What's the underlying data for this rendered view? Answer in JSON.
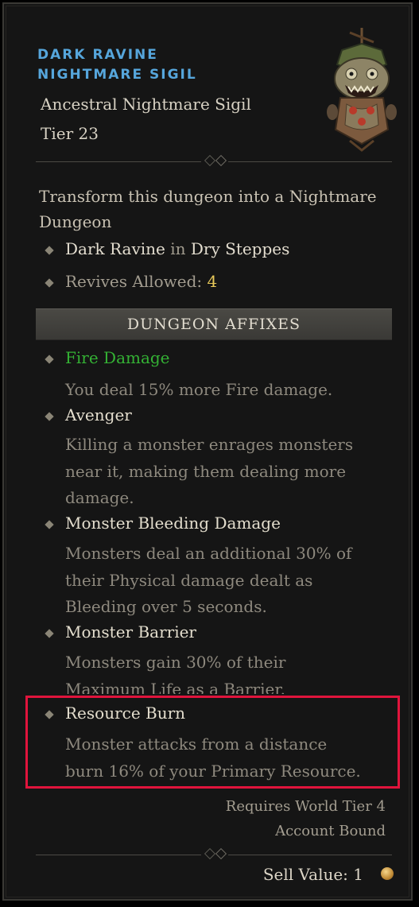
{
  "item": {
    "name_line1": "Dark Ravine",
    "name_line2": "Nightmare Sigil",
    "type": "Ancestral Nightmare Sigil",
    "tier": "Tier 23",
    "image_icon": "nightmare-sigil-icon"
  },
  "description": "Transform this dungeon into a Nightmare Dungeon",
  "location": {
    "dungeon": "Dark Ravine",
    "connector": "in",
    "region": "Dry Steppes"
  },
  "revives": {
    "label": "Revives Allowed:",
    "value": "4"
  },
  "affixes": {
    "header": "DUNGEON AFFIXES",
    "items": [
      {
        "name": "Fire Damage",
        "lines": [
          "You deal 15% more Fire damage."
        ],
        "color": "#34b234"
      },
      {
        "name": "Avenger",
        "lines": [
          "Killing a monster enrages monsters",
          "near it, making them dealing more",
          "damage."
        ]
      },
      {
        "name": "Monster Bleeding Damage",
        "lines": [
          "Monsters deal an additional 30% of",
          "their Physical damage dealt as",
          "Bleeding over 5 seconds."
        ]
      },
      {
        "name": "Monster Barrier",
        "lines": [
          "Monsters gain 30% of their",
          "Maximum Life as a Barrier."
        ]
      },
      {
        "name": "Resource Burn",
        "lines": [
          "Monster attacks from a distance",
          "burn 16% of your Primary Resource."
        ]
      }
    ]
  },
  "requirements": {
    "world_tier": "Requires World Tier 4",
    "bound": "Account Bound"
  },
  "sell": {
    "label": "Sell Value: 1",
    "icon": "gold-coin-icon"
  },
  "colors": {
    "title_blue": "#56a6dc",
    "affix_green": "#34b234",
    "highlight_red": "#e0143c",
    "revives_yellow": "#e8c95a"
  }
}
